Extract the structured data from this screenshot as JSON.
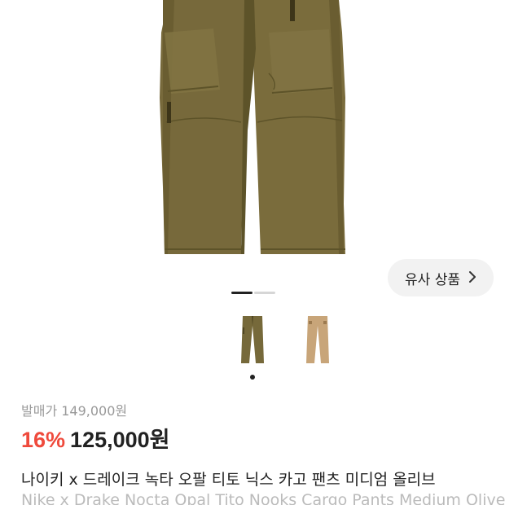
{
  "product": {
    "image_alt_icon": "cargo-pants-image",
    "colors": {
      "olive": "#76693a",
      "olive_dark": "#4e4522",
      "tan": "#c8a579",
      "tan_dark": "#9c7a4f"
    }
  },
  "similar_button": {
    "label": "유사 상품",
    "icon": "chevron-right-icon"
  },
  "pagination": {
    "current": 1,
    "total": 2
  },
  "thumbnails": [
    {
      "name": "olive",
      "selected": true
    },
    {
      "name": "tan",
      "selected": false
    }
  ],
  "pricing": {
    "original_label": "발매가 149,000원",
    "discount": "16%",
    "price": "125,000원",
    "accent_color": "#ef4a3c"
  },
  "title": {
    "ko": "나이키 x 드레이크 녹타 오팔 티토 닉스 카고 팬츠 미디엄 올리브",
    "en": "Nike x Drake Nocta Opal Tito Nooks Cargo Pants Medium Olive"
  }
}
